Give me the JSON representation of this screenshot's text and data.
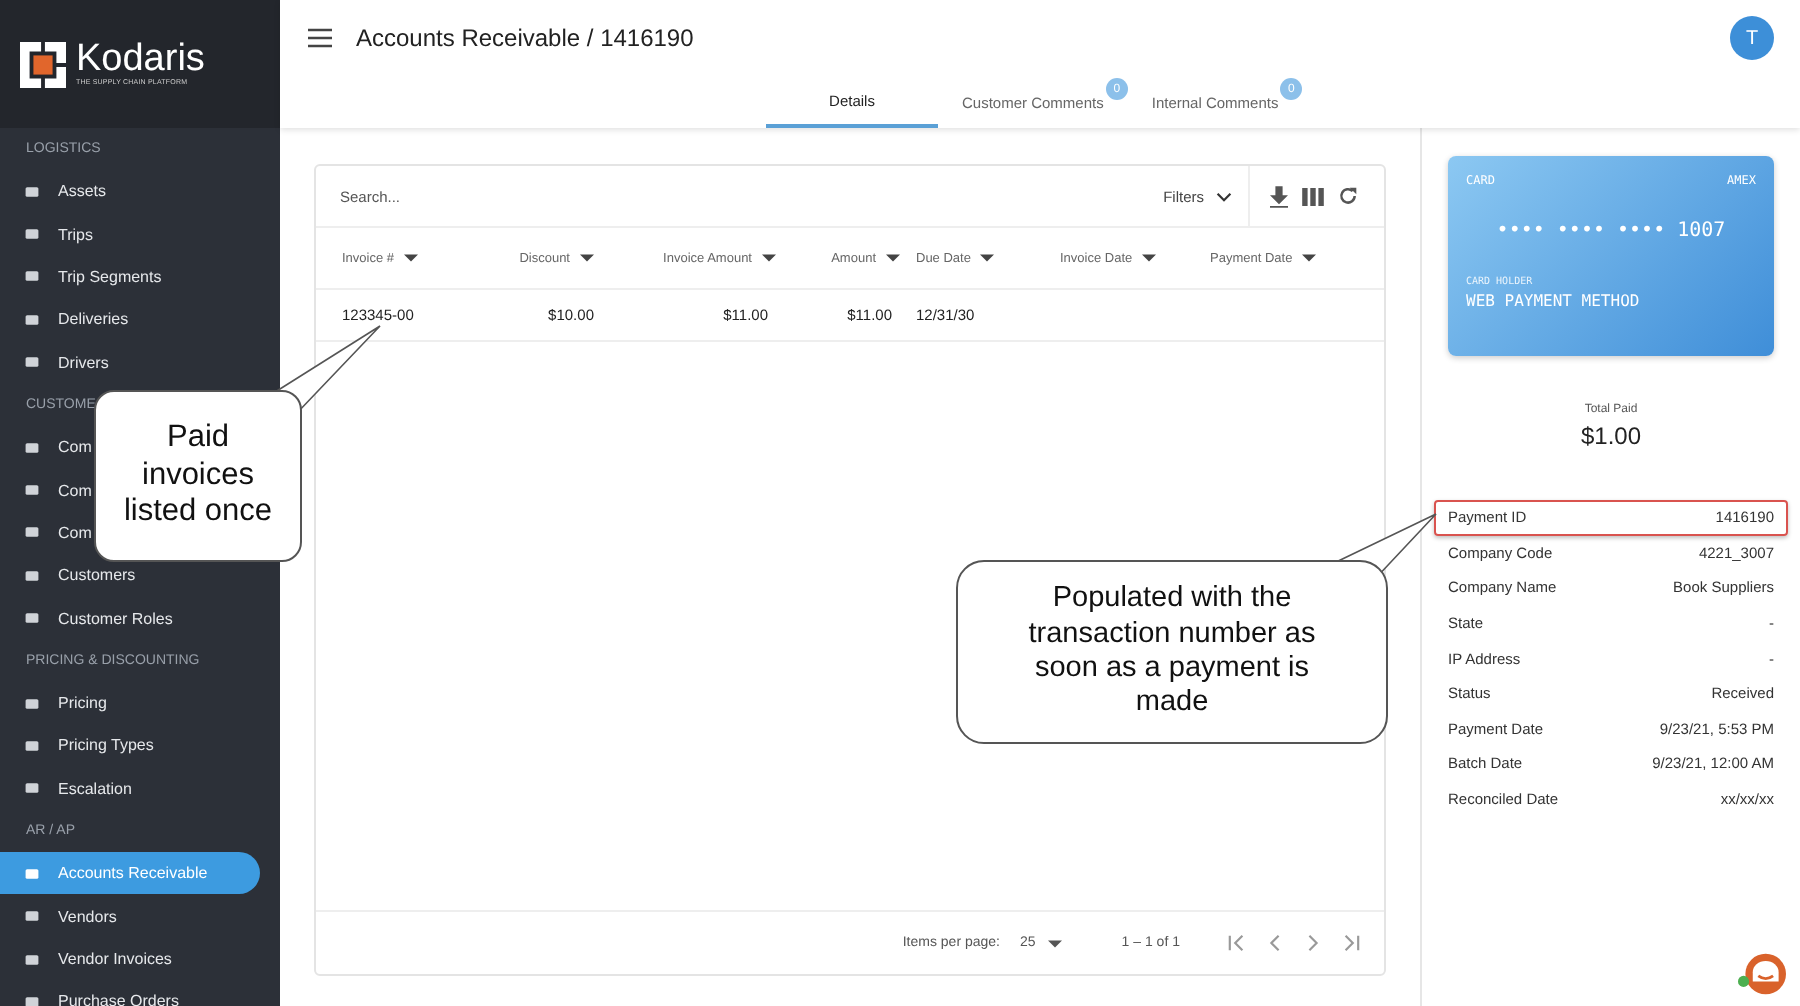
{
  "brand": {
    "name": "Kodaris",
    "tagline": "THE SUPPLY CHAIN PLATFORM"
  },
  "sidebar": {
    "sections": [
      {
        "label": "LOGISTICS",
        "items": [
          {
            "label": "Assets",
            "selected": false
          },
          {
            "label": "Trips",
            "selected": false
          },
          {
            "label": "Trip Segments",
            "selected": false
          },
          {
            "label": "Deliveries",
            "selected": false
          },
          {
            "label": "Drivers",
            "selected": false
          }
        ]
      },
      {
        "label": "CUSTOME",
        "items": [
          {
            "label": "Com",
            "selected": false
          },
          {
            "label": "Com",
            "selected": false
          },
          {
            "label": "Com",
            "selected": false
          },
          {
            "label": "Customers",
            "selected": false
          },
          {
            "label": "Customer Roles",
            "selected": false
          }
        ]
      },
      {
        "label": "PRICING & DISCOUNTING",
        "items": [
          {
            "label": "Pricing",
            "selected": false
          },
          {
            "label": "Pricing Types",
            "selected": false
          },
          {
            "label": "Escalation",
            "selected": false
          }
        ]
      },
      {
        "label": "AR / AP",
        "items": [
          {
            "label": "Accounts Receivable",
            "selected": true
          },
          {
            "label": "Vendors",
            "selected": false
          },
          {
            "label": "Vendor Invoices",
            "selected": false
          },
          {
            "label": "Purchase Orders",
            "selected": false
          }
        ]
      }
    ]
  },
  "header": {
    "title": "Accounts Receivable / 1416190",
    "avatar": "T"
  },
  "tabs": [
    {
      "label": "Details",
      "selected": true
    },
    {
      "label": "Customer Comments",
      "badge": "0",
      "selected": false
    },
    {
      "label": "Internal Comments",
      "badge": "0",
      "selected": false
    }
  ],
  "table": {
    "search_placeholder": "Search...",
    "filters": "Filters",
    "columns": [
      {
        "label": "Invoice #",
        "numeric": false
      },
      {
        "label": "Discount",
        "numeric": true
      },
      {
        "label": "Invoice Amount",
        "numeric": true
      },
      {
        "label": "Amount",
        "numeric": true
      },
      {
        "label": "Due Date",
        "numeric": false
      },
      {
        "label": "Invoice Date",
        "numeric": false
      },
      {
        "label": "Payment Date",
        "numeric": false
      }
    ],
    "rows": [
      [
        "123345-00",
        "$10.00",
        "$11.00",
        "$11.00",
        "12/31/30",
        "",
        ""
      ]
    ]
  },
  "pagination": {
    "items_per_page_label": "Items per page:",
    "page_size": "25",
    "range": "1 – 1 of 1"
  },
  "card": {
    "type_label": "CARD",
    "brand": "AMEX",
    "number": "•••• •••• •••• 1007",
    "holder_label": "CARD HOLDER",
    "holder": "WEB PAYMENT METHOD"
  },
  "total": {
    "label": "Total Paid",
    "amount": "$1.00"
  },
  "details": [
    {
      "label": "Payment ID",
      "value": "1416190",
      "highlighted": true
    },
    {
      "label": "Company Code",
      "value": "4221_3007",
      "highlighted": false
    },
    {
      "label": "Company Name",
      "value": "Book Suppliers",
      "highlighted": false
    },
    {
      "label": "State",
      "value": "-",
      "highlighted": false
    },
    {
      "label": "IP Address",
      "value": "-",
      "highlighted": false
    },
    {
      "label": "Status",
      "value": "Received",
      "highlighted": false
    },
    {
      "label": "Payment Date",
      "value": "9/23/21, 5:53 PM",
      "highlighted": false
    },
    {
      "label": "Batch Date",
      "value": "9/23/21, 12:00 AM",
      "highlighted": false
    },
    {
      "label": "Reconciled Date",
      "value": "xx/xx/xx",
      "highlighted": false
    }
  ],
  "annotations": [
    {
      "text": "Paid invoices listed once"
    },
    {
      "text": "Populated with the transaction number as soon as a payment is made"
    }
  ]
}
